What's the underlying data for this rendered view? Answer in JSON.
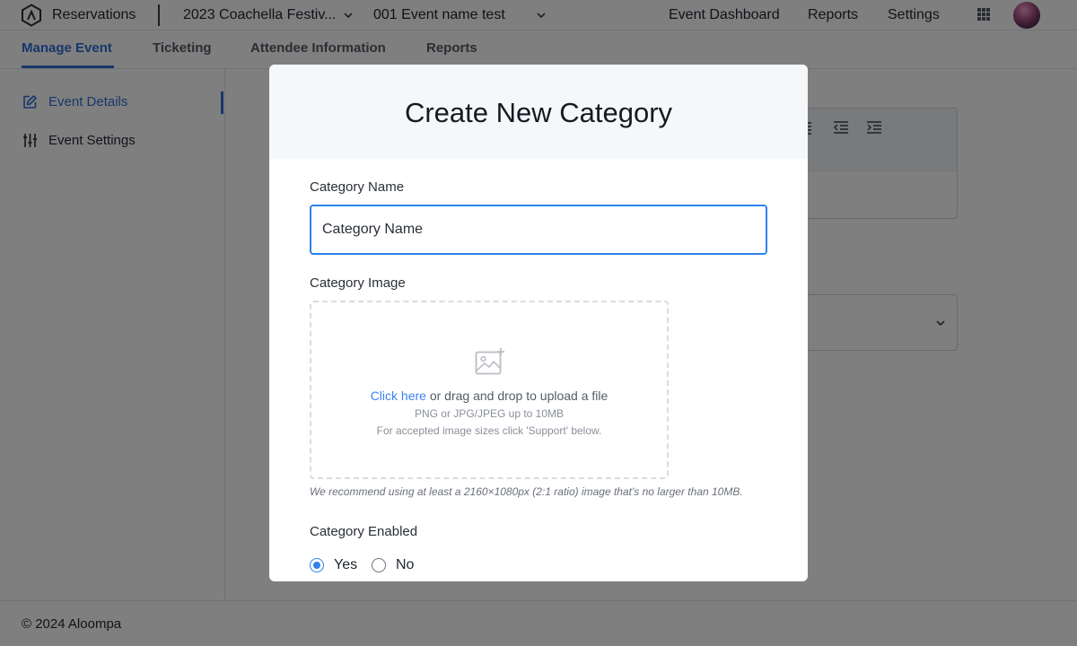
{
  "topbar": {
    "brand_label": "Reservations",
    "festival_select": "2023 Coachella Festiv...",
    "event_select": "001 Event name test",
    "nav": [
      "Event Dashboard",
      "Reports",
      "Settings"
    ],
    "apps_icon": "grid-icon",
    "avatar_icon": "avatar"
  },
  "subnav": {
    "tabs": [
      "Manage Event",
      "Ticketing",
      "Attendee Information",
      "Reports"
    ],
    "active_tab": "Manage Event"
  },
  "sidebar": {
    "items": [
      {
        "label": "Event Details",
        "icon": "edit-icon",
        "active": true
      },
      {
        "label": "Event Settings",
        "icon": "sliders-icon",
        "active": false
      }
    ]
  },
  "footer": {
    "text": "© 2024 Aloompa"
  },
  "modal": {
    "title": "Create New Category",
    "name_label": "Category Name",
    "name_placeholder": "Category Name",
    "name_value": "",
    "image_label": "Category Image",
    "upload_link": "Click here",
    "upload_text": " or drag and drop to upload a file",
    "upload_formats": "PNG or JPG/JPEG up to 10MB",
    "upload_support": "For accepted image sizes click 'Support' below.",
    "image_hint": "We recommend using at least a 2160×1080px (2:1 ratio) image that's no larger than 10MB.",
    "enabled_label": "Category Enabled",
    "options": [
      "Yes",
      "No"
    ],
    "selected": "Yes"
  },
  "colors": {
    "accent": "#2f80ed",
    "link": "#3b82f6",
    "overlay": "rgba(0,0,0,0.5)"
  }
}
